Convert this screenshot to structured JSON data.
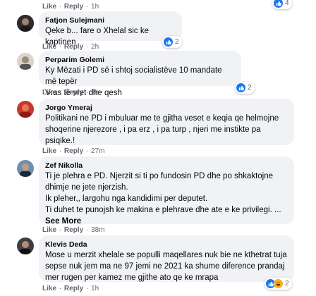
{
  "top": {
    "like": "Like",
    "reply": "Reply",
    "time": "1h",
    "reactions": "4"
  },
  "comments": [
    {
      "author": "Fatjon Sulejmani",
      "text": "Qeke b... fare o Xhelal sic ke kaptinen",
      "like": "Like",
      "reply": "Reply",
      "time": "2h",
      "reactions": "2"
    },
    {
      "author": "Perparim Golemi",
      "text": "Ky Mëzati i PD së i shtoj socialistëve 10 mandate më tepër\nVras të vret dhe qesh",
      "like": "Like",
      "reply": "Reply",
      "time": "1h",
      "reactions": "2"
    },
    {
      "author": "Jorgo Ymeraj",
      "text": "Politikani ne PD i mbuluar me te gjitha veset e keqia qe helmojne\nshoqerine njerezore , i pa erz , i pa turp , njeri me instikte pa\npsiqike.!",
      "like": "Like",
      "reply": "Reply",
      "time": "27m"
    },
    {
      "author": "Zef Nikolla",
      "text": "Ti je plehra e PD. Njerzit si ti po fundosin PD dhe po shkaktojne\ndhimje ne jete njerzish.\nIk pleher,, largohu nga kandidimi per deputet.\nTi duhet te punojsh ke makina e plehrave dhe ate e ke privilegi. ...",
      "see_more": "See More",
      "like": "Like",
      "reply": "Reply",
      "time": "38m"
    },
    {
      "author": "Klevis Deda",
      "text": "Mose u merzit xhelale se populli maqellares nuk bie ne kthetrat tuja\nsepse nuk jem ma ne 97 jemi ne 2021 ka shume diference prandaj\nmer rugen per kamez me gjithe ato qe ke mrapa",
      "like": "Like",
      "reply": "Reply",
      "time": "1h",
      "reactions": "2"
    }
  ],
  "colors": {
    "like_blue": "#1877f2",
    "bubble": "#f0f2f5",
    "meta": "#65676b"
  }
}
